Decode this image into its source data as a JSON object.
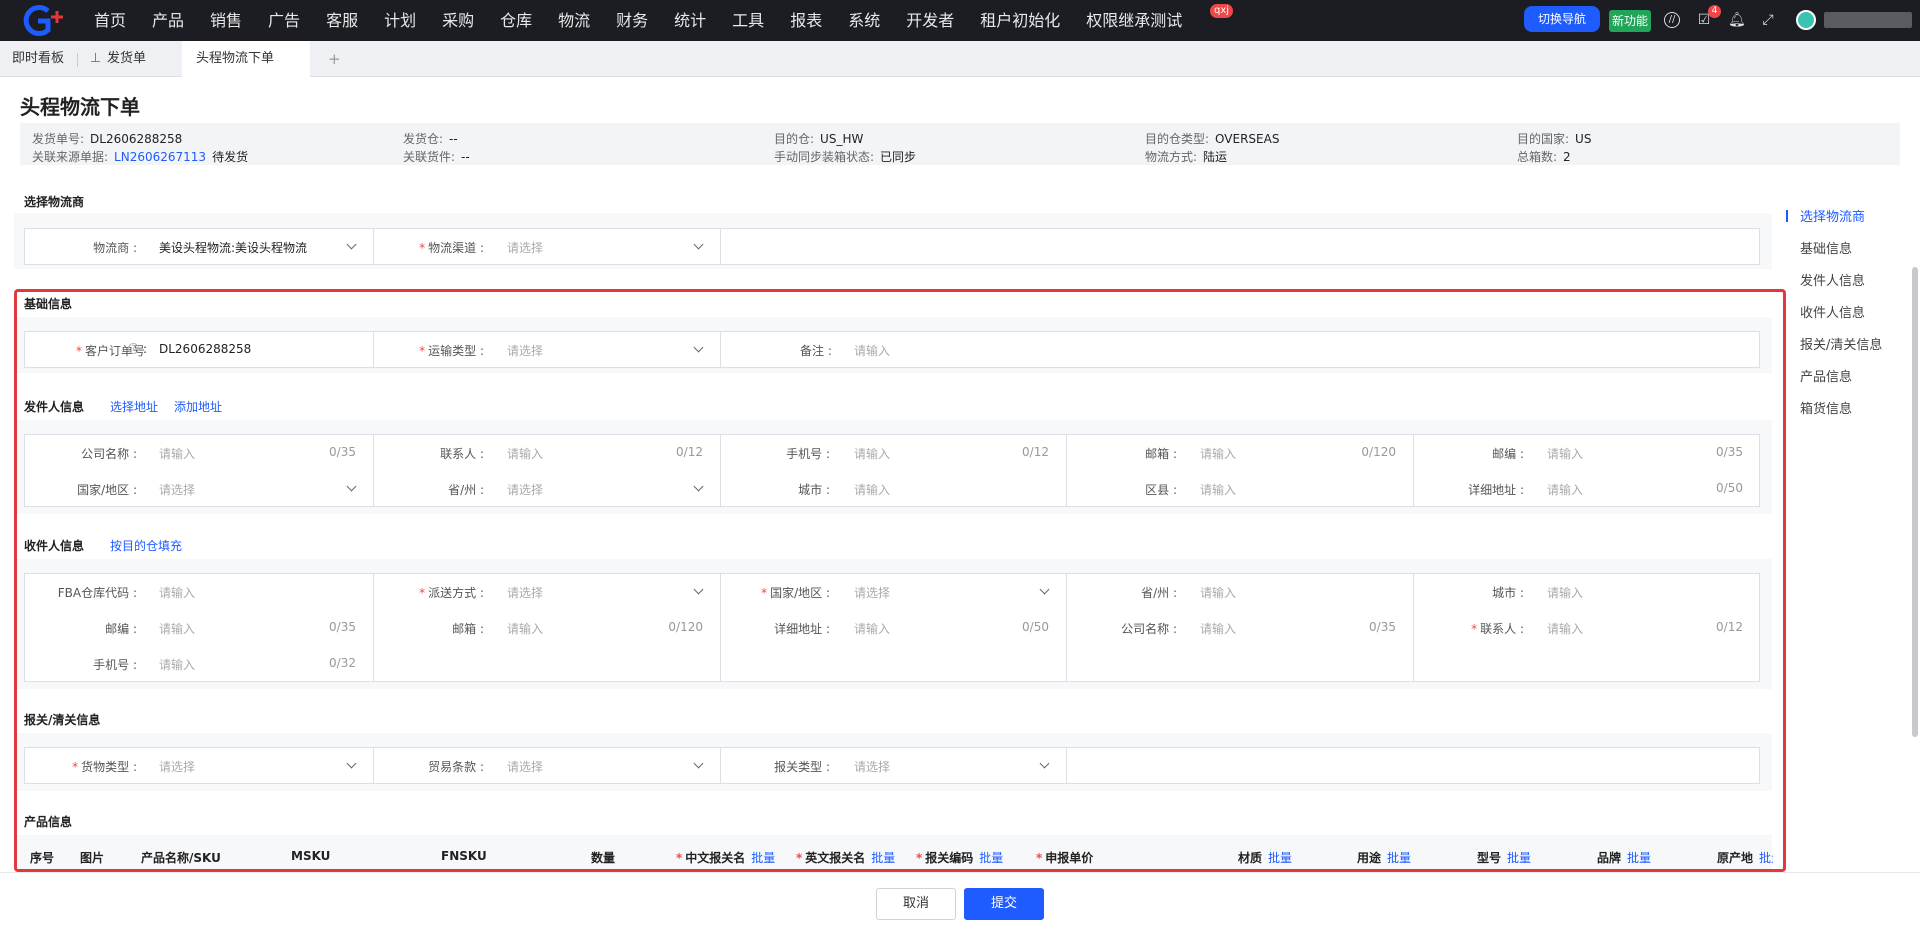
{
  "topbar": {
    "nav": [
      "首页",
      "产品",
      "销售",
      "广告",
      "客服",
      "计划",
      "采购",
      "仓库",
      "物流",
      "财务",
      "统计",
      "工具",
      "报表",
      "系统",
      "开发者",
      "租户初始化",
      "权限继承测试"
    ],
    "qxj_badge": "qxj",
    "switch_nav": "切换导航",
    "new_feature": "新功能",
    "task_count": "4",
    "accent": "#1e5cff"
  },
  "tabs": [
    {
      "label": "即时看板"
    },
    {
      "label": "发货单"
    },
    {
      "label": "头程物流下单"
    },
    {
      "label": "+"
    }
  ],
  "page_title": "头程物流下单",
  "summary": {
    "ship_no_label": "发货单号:",
    "ship_no": "DL2606288258",
    "ship_wh_label": "发货仓:",
    "ship_wh": "--",
    "dest_wh_label": "目的仓:",
    "dest_wh": "US_HW",
    "dest_wh_type_label": "目的仓类型:",
    "dest_wh_type": "OVERSEAS",
    "dest_country_label": "目的国家:",
    "dest_country": "US",
    "source_label": "关联来源单据:",
    "source_no": "LN2606267113",
    "source_status": "待发货",
    "related_label": "关联货件:",
    "related": "--",
    "sync_label": "手动同步装箱状态:",
    "sync": "已同步",
    "method_label": "物流方式:",
    "method": "陆运",
    "boxes_label": "总箱数:",
    "boxes": "2"
  },
  "sections": {
    "carrier": "选择物流商",
    "basic": "基础信息",
    "sender": "发件人信息",
    "sender_select": "选择地址",
    "sender_add": "添加地址",
    "receiver": "收件人信息",
    "receiver_fill": "按目的仓填充",
    "customs": "报关/清关信息",
    "product": "产品信息"
  },
  "carrier_form": {
    "carrier_label": "物流商",
    "carrier_value": "美设头程物流:美设头程物流",
    "channel_label": "物流渠道",
    "channel_ph": "请选择"
  },
  "basic_form": {
    "order_label": "客户订单号",
    "order_value": "DL2606288258",
    "transport_label": "运输类型",
    "transport_ph": "请选择",
    "remark_label": "备注",
    "remark_ph": "请输入"
  },
  "sender_form": {
    "company_label": "公司名称",
    "company_cnt": "0/35",
    "contact_label": "联系人",
    "contact_cnt": "0/12",
    "phone_label": "手机号",
    "phone_cnt": "0/12",
    "email_label": "邮箱",
    "email_cnt": "0/120",
    "zip_label": "邮编",
    "zip_cnt": "0/35",
    "country_label": "国家/地区",
    "province_label": "省/州",
    "city_label": "城市",
    "district_label": "区县",
    "address_label": "详细地址",
    "address_cnt": "0/50"
  },
  "receiver_form": {
    "fba_label": "FBA仓库代码",
    "delivery_label": "派送方式",
    "country_label": "国家/地区",
    "province_label": "省/州",
    "city_label": "城市",
    "zip_label": "邮编",
    "zip_cnt": "0/35",
    "email_label": "邮箱",
    "email_cnt": "0/120",
    "address_label": "详细地址",
    "address_cnt": "0/50",
    "company_label": "公司名称",
    "company_cnt": "0/35",
    "contact_label": "联系人",
    "contact_cnt": "0/12",
    "phone_label": "手机号",
    "phone_cnt": "0/32"
  },
  "customs_form": {
    "goods_label": "货物类型",
    "trade_label": "贸易条款",
    "customs_label": "报关类型"
  },
  "placeholders": {
    "input": "请输入",
    "select": "请选择"
  },
  "product_table": {
    "headers": [
      "序号",
      "图片",
      "产品名称/SKU",
      "MSKU",
      "FNSKU",
      "数量",
      "中文报关名",
      "英文报关名",
      "报关编码",
      "申报单价",
      "材质",
      "用途",
      "型号",
      "品牌",
      "原产地"
    ],
    "batch": "批量"
  },
  "anchors": [
    "选择物流商",
    "基础信息",
    "发件人信息",
    "收件人信息",
    "报关/清关信息",
    "产品信息",
    "箱货信息"
  ],
  "footer": {
    "cancel": "取消",
    "submit": "提交"
  }
}
